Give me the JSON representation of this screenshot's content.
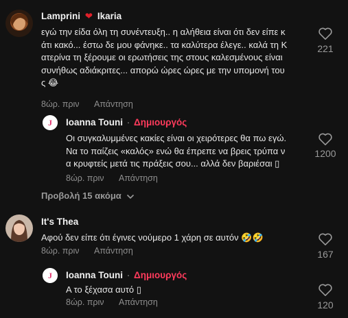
{
  "comments": [
    {
      "name": "Lamprini",
      "name_suffix": "Ikaria",
      "text_lines": [
        "εγώ την είδα όλη τη συνέντευξη.. η αλήθεια είναι ότι δεν είπε κ",
        "άτι κακό... έστω δε μου φάνηκε.. τα καλύτερα έλεγε.. καλά τη Κ",
        "ατερίνα τη ξέρουμε οι ερωτήσεις της στους καλεσμένους είναι",
        "συνήθως αδιάκριτες... απορώ ώρες ώρες με την υπομονή του",
        "ς 😂"
      ],
      "time": "8ώρ. πριν",
      "reply": "Απάντηση",
      "likes": "221"
    },
    {
      "name": "Ioanna Touni",
      "separator": "·",
      "badge": "Δημιουργός",
      "text_lines": [
        "Οι συγκαλυμμένες κακίες είναι οι χειρότερες θα πω εγώ.",
        "Να το παίζεις «καλός» ενώ θα έπρεπε να βρεις τρύπα ν",
        "α κρυφτείς μετά τις πράξεις σου... αλλά δεν βαριέσαι ▯"
      ],
      "time": "8ώρ. πριν",
      "reply": "Απάντηση",
      "likes": "1200"
    },
    {
      "name": "It's Thea",
      "text_lines": [
        "Αφού δεν είπε ότι έγινες νούμερο 1 χάρη σε αυτόν 🤣🤣"
      ],
      "time": "8ώρ. πριν",
      "reply": "Απάντηση",
      "likes": "167"
    },
    {
      "name": "Ioanna Touni",
      "separator": "·",
      "badge": "Δημιουργός",
      "text_lines": [
        "Α το ξέχασα αυτό ▯"
      ],
      "time": "8ώρ. πριν",
      "reply": "Απάντηση",
      "likes": "120"
    }
  ],
  "view_more": "Προβολή 15 ακόμα"
}
